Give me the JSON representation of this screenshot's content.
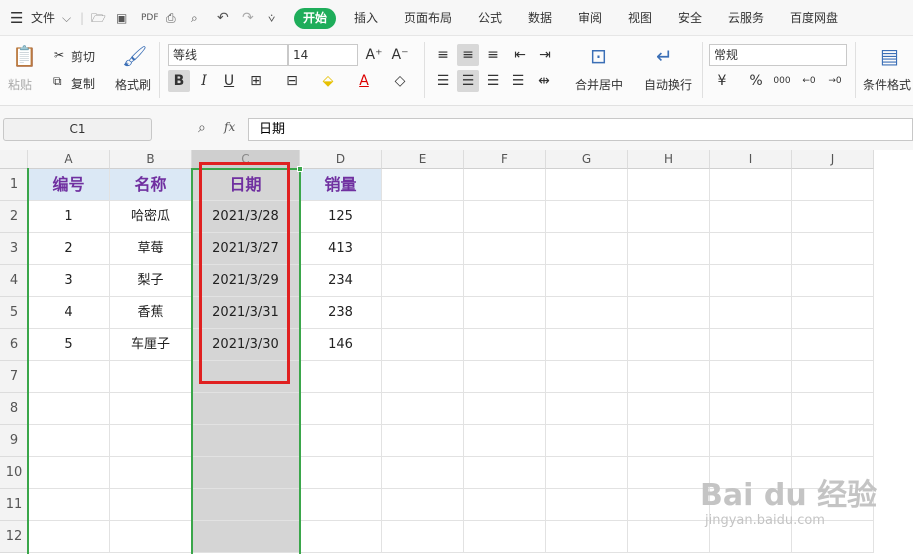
{
  "menubar": {
    "file": "文件",
    "tabs": [
      "开始",
      "插入",
      "页面布局",
      "公式",
      "数据",
      "审阅",
      "视图",
      "安全",
      "云服务",
      "百度网盘"
    ],
    "active_tab": "开始"
  },
  "ribbon": {
    "paste": "粘贴",
    "cut": "剪切",
    "copy": "复制",
    "format_painter": "格式刷",
    "font_name": "等线",
    "font_size": "14",
    "bold": "B",
    "italic": "I",
    "underline": "U",
    "merge": "合并居中",
    "wrap": "自动换行",
    "number_format": "常规",
    "percent": "%",
    "thousands": "000",
    "cond_format": "条件格式"
  },
  "formula_bar": {
    "cell_ref": "C1",
    "fx": "fx",
    "value": "日期"
  },
  "sheet": {
    "columns": [
      "A",
      "B",
      "C",
      "D",
      "E",
      "F",
      "G",
      "H",
      "I",
      "J"
    ],
    "rows": [
      "1",
      "2",
      "3",
      "4",
      "5",
      "6",
      "7",
      "8",
      "9",
      "10",
      "11",
      "12"
    ],
    "headers": [
      "编号",
      "名称",
      "日期",
      "销量"
    ],
    "data": [
      [
        "1",
        "哈密瓜",
        "2021/3/28",
        "125"
      ],
      [
        "2",
        "草莓",
        "2021/3/27",
        "413"
      ],
      [
        "3",
        "梨子",
        "2021/3/29",
        "234"
      ],
      [
        "4",
        "香蕉",
        "2021/3/31",
        "238"
      ],
      [
        "5",
        "车厘子",
        "2021/3/30",
        "146"
      ]
    ]
  },
  "watermark": {
    "brand": "Bai du 经验",
    "url": "jingyan.baidu.com"
  }
}
